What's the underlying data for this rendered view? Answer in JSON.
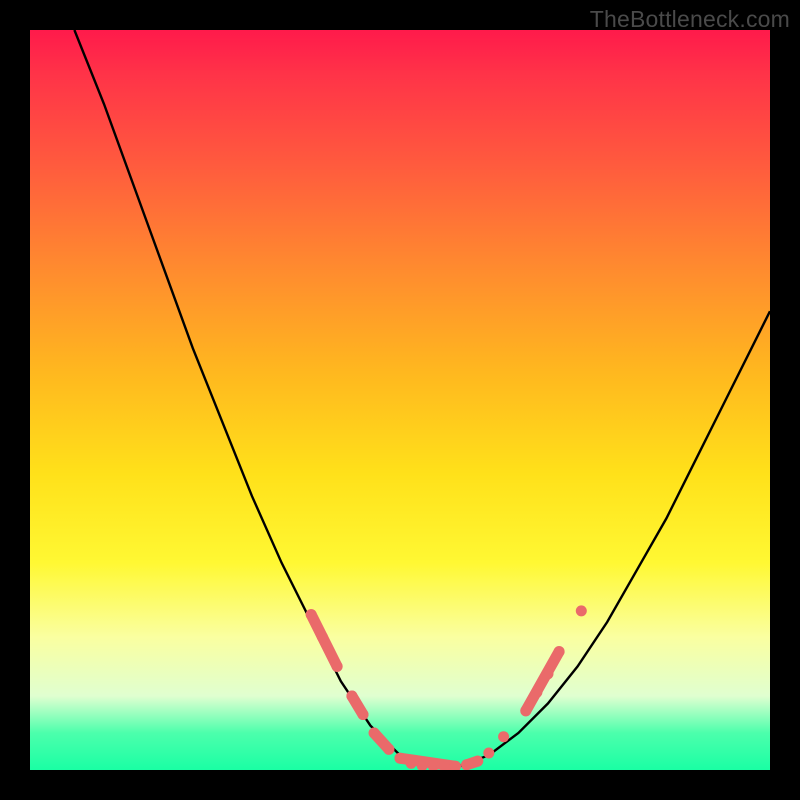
{
  "watermark": "TheBottleneck.com",
  "colors": {
    "curve_stroke": "#000000",
    "marker_stroke": "#ea6a6a",
    "marker_fill": "#ea6a6a"
  },
  "chart_data": {
    "type": "line",
    "title": "",
    "xlabel": "",
    "ylabel": "",
    "xlim": [
      0,
      100
    ],
    "ylim": [
      0,
      100
    ],
    "series": [
      {
        "name": "left-branch",
        "x": [
          6,
          10,
          14,
          18,
          22,
          26,
          30,
          34,
          38,
          42,
          46,
          50,
          54
        ],
        "y": [
          100,
          90,
          79,
          68,
          57,
          47,
          37,
          28,
          20,
          12,
          6,
          2,
          0.5
        ]
      },
      {
        "name": "right-branch",
        "x": [
          54,
          58,
          62,
          66,
          70,
          74,
          78,
          82,
          86,
          90,
          94,
          98,
          100
        ],
        "y": [
          0.5,
          0.5,
          2,
          5,
          9,
          14,
          20,
          27,
          34,
          42,
          50,
          58,
          62
        ]
      }
    ],
    "markers": [
      {
        "x": 38.0,
        "y": 21.0
      },
      {
        "x": 39.5,
        "y": 18.0
      },
      {
        "x": 41.5,
        "y": 14.0
      },
      {
        "x": 43.5,
        "y": 10.0
      },
      {
        "x": 45.0,
        "y": 7.5
      },
      {
        "x": 46.5,
        "y": 5.0
      },
      {
        "x": 48.5,
        "y": 2.8
      },
      {
        "x": 50.0,
        "y": 1.6
      },
      {
        "x": 51.5,
        "y": 0.9
      },
      {
        "x": 53.0,
        "y": 0.6
      },
      {
        "x": 54.5,
        "y": 0.5
      },
      {
        "x": 56.0,
        "y": 0.5
      },
      {
        "x": 57.5,
        "y": 0.5
      },
      {
        "x": 59.0,
        "y": 0.7
      },
      {
        "x": 60.5,
        "y": 1.2
      },
      {
        "x": 62.0,
        "y": 2.3
      },
      {
        "x": 64.0,
        "y": 4.5
      },
      {
        "x": 67.0,
        "y": 8.0
      },
      {
        "x": 68.5,
        "y": 10.5
      },
      {
        "x": 70.0,
        "y": 13.0
      },
      {
        "x": 71.5,
        "y": 16.0
      },
      {
        "x": 74.5,
        "y": 21.5
      }
    ],
    "marker_segments": [
      {
        "x1": 38.0,
        "y1": 21.0,
        "x2": 41.5,
        "y2": 14.0
      },
      {
        "x1": 43.5,
        "y1": 10.0,
        "x2": 45.0,
        "y2": 7.5
      },
      {
        "x1": 46.5,
        "y1": 5.0,
        "x2": 48.5,
        "y2": 2.8
      },
      {
        "x1": 50.0,
        "y1": 1.6,
        "x2": 57.5,
        "y2": 0.5
      },
      {
        "x1": 59.0,
        "y1": 0.7,
        "x2": 60.5,
        "y2": 1.2
      },
      {
        "x1": 67.0,
        "y1": 8.0,
        "x2": 71.5,
        "y2": 16.0
      }
    ]
  }
}
